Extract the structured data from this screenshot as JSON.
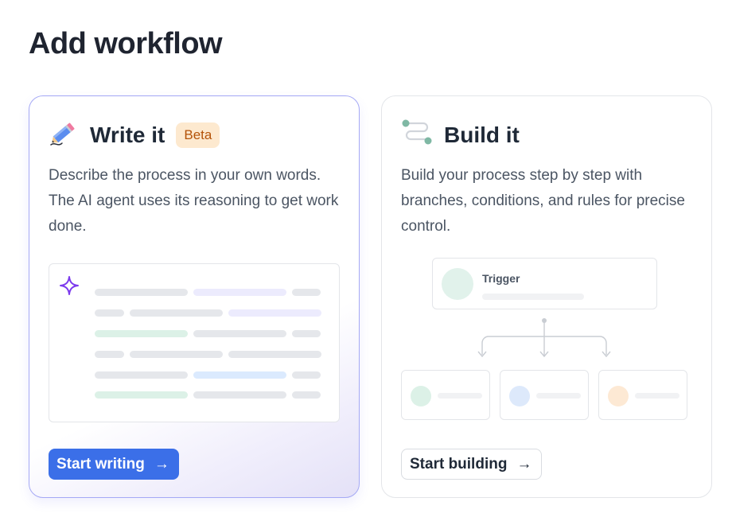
{
  "page": {
    "title": "Add workflow"
  },
  "write_card": {
    "icon": "pencil-icon",
    "title": "Write it",
    "badge": "Beta",
    "description": "Describe the process in your own words. The AI agent uses its reasoning to get work done.",
    "preview_icon": "sparkle-icon",
    "button_label": "Start writing",
    "button_icon": "arrow-right-icon",
    "colors": {
      "accent": "#3b6fe8",
      "border": "#a5a9f5",
      "badge_bg": "#fde9cf",
      "badge_text": "#b45309",
      "sparkle": "#7c3aed"
    }
  },
  "build_card": {
    "icon": "workflow-icon",
    "title": "Build it",
    "description": "Build your process step by step with branches, conditions, and rules for precise control.",
    "diagram": {
      "trigger_label": "Trigger",
      "node_colors": [
        "#dcf1e7",
        "#dde9fb",
        "#fde9d4"
      ]
    },
    "button_label": "Start building",
    "button_icon": "arrow-right-icon"
  }
}
